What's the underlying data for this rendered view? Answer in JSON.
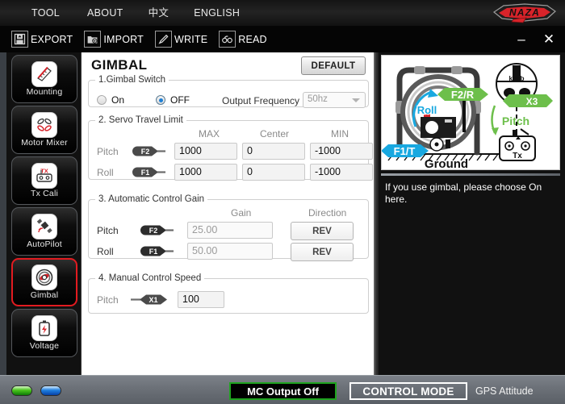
{
  "menu": {
    "items": [
      {
        "label": "TOOL",
        "name": "menu-tool"
      },
      {
        "label": "ABOUT",
        "name": "menu-about"
      },
      {
        "label": "中文",
        "name": "menu-chinese"
      },
      {
        "label": "ENGLISH",
        "name": "menu-english"
      }
    ]
  },
  "brand": {
    "logo_text": "NAZA",
    "logo_color": "#d8232a"
  },
  "toolbar": {
    "items": [
      {
        "label": "EXPORT",
        "icon": "floppy-export-icon"
      },
      {
        "label": "IMPORT",
        "icon": "folder-import-icon"
      },
      {
        "label": "WRITE",
        "icon": "pencil-write-icon"
      },
      {
        "label": "READ",
        "icon": "glasses-read-icon"
      }
    ],
    "minimize": "–",
    "close": "✕"
  },
  "sidebar": {
    "items": [
      {
        "label": "Mounting",
        "icon": "ruler-mounting-icon",
        "active": false
      },
      {
        "label": "Motor Mixer",
        "icon": "propellers-icon",
        "active": false
      },
      {
        "label": "Tx Cali",
        "icon": "transmitter-icon",
        "active": false
      },
      {
        "label": "AutoPilot",
        "icon": "satellite-icon",
        "active": false
      },
      {
        "label": "Gimbal",
        "icon": "gimbal-icon",
        "active": true
      },
      {
        "label": "Voltage",
        "icon": "battery-icon",
        "active": false
      }
    ]
  },
  "main": {
    "title": "GIMBAL",
    "default_button": "DEFAULT",
    "gimbal_switch": {
      "legend": "1.Gimbal Switch",
      "on_label": "On",
      "off_label": "OFF",
      "selected": "OFF",
      "output_frequency_label": "Output Frequency",
      "output_frequency_value": "50hz",
      "output_frequency_options": [
        "50hz"
      ]
    },
    "servo_travel_limit": {
      "legend": "2. Servo Travel Limit",
      "columns": [
        "MAX",
        "Center",
        "MIN"
      ],
      "rows": [
        {
          "label": "Pitch",
          "channel": "F2",
          "max": "1000",
          "center": "0",
          "min": "-1000"
        },
        {
          "label": "Roll",
          "channel": "F1",
          "max": "1000",
          "center": "0",
          "min": "-1000"
        }
      ]
    },
    "automatic_control_gain": {
      "legend": "3. Automatic Control Gain",
      "columns": [
        "Gain",
        "Direction"
      ],
      "rows": [
        {
          "label": "Pitch",
          "channel": "F2",
          "gain": "25.00",
          "direction": "REV"
        },
        {
          "label": "Roll",
          "channel": "F1",
          "gain": "50.00",
          "direction": "REV"
        }
      ]
    },
    "manual_control_speed": {
      "legend": "4. Manual Control Speed",
      "row": {
        "label": "Pitch",
        "channel": "X1",
        "value": "100"
      }
    }
  },
  "right": {
    "diagram": {
      "labels": {
        "f2r": "F2/R",
        "roll": "Roll",
        "f1t": "F1/T",
        "ground": "Ground",
        "knob": "knob",
        "x3": "X3",
        "pitch": "Pitch",
        "tx": "Tx"
      }
    },
    "help_text": "If you use gimbal, please choose On here."
  },
  "status": {
    "led_green": "green-status-led",
    "led_blue": "blue-status-led",
    "mc_output": "MC Output Off",
    "control_mode": "CONTROL MODE",
    "gps_mode": "GPS Attitude"
  }
}
